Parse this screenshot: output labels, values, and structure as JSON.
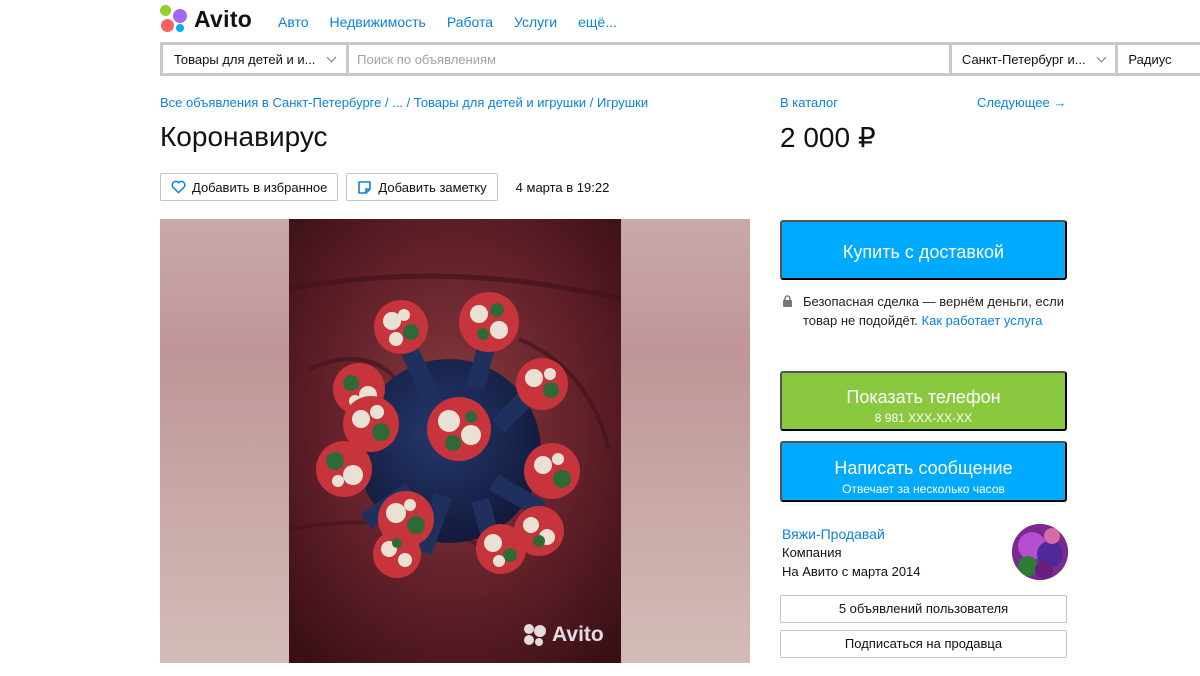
{
  "brand": {
    "logo_text": "Avito",
    "dot_colors": [
      "#97cf26",
      "#a169f7",
      "#ff6163",
      "#00aaff"
    ]
  },
  "topnav": [
    "Авто",
    "Недвижимость",
    "Работа",
    "Услуги",
    "ещё..."
  ],
  "search": {
    "category": "Товары для детей и и...",
    "placeholder": "Поиск по объявлениям",
    "city": "Санкт-Петербург и...",
    "radius": "Радиус"
  },
  "breadcrumb": {
    "parts": [
      "Все объявления в Санкт-Петербурге",
      "...",
      "Товары для детей и игрушки",
      "Игрушки"
    ],
    "separator": " / "
  },
  "catalog_link": "В каталог",
  "next_link": "Следующее →",
  "listing": {
    "title": "Коронавирус",
    "price": "2 000 ₽",
    "add_favorite": "Добавить в избранное",
    "add_note": "Добавить заметку",
    "date": "4 марта в 19:22"
  },
  "gallery": {
    "watermark": "Avito"
  },
  "buy_button": "Купить с доставкой",
  "safe_deal": {
    "text": "Безопасная сделка — вернём деньги, если товар не подойдёт.",
    "link": "Как работает услуга"
  },
  "phone_button": {
    "label": "Показать телефон",
    "number": "8 981 XXX-XX-XX"
  },
  "message_button": {
    "label": "Написать сообщение",
    "sub": "Отвечает за несколько часов"
  },
  "seller": {
    "name": "Вяжи-Продавай",
    "type": "Компания",
    "since": "На Авито с марта 2014"
  },
  "seller_ads_button": "5 объявлений пользователя",
  "subscribe_button": "Подписаться на продавца",
  "colors": {
    "link": "#0a83dc",
    "buy": "#00aaff",
    "phone": "#8ac83f"
  }
}
